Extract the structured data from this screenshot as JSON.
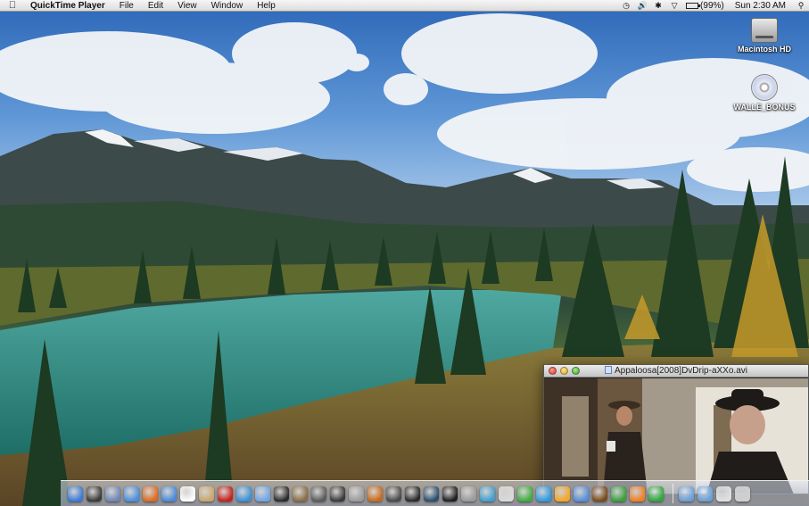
{
  "menubar": {
    "apple_icon": "apple-icon",
    "app_name": "QuickTime Player",
    "menus": [
      "File",
      "Edit",
      "View",
      "Window",
      "Help"
    ],
    "status_icons": [
      "time-machine-icon",
      "volume-icon",
      "bluetooth-icon",
      "wifi-icon",
      "battery-icon"
    ],
    "battery_text": "(99%)",
    "battery_level": 0.99,
    "clock": "Sun 2:30 AM",
    "spotlight_icon": "spotlight-icon"
  },
  "desktop": {
    "icons": [
      {
        "label": "Macintosh HD",
        "icon": "hard-drive-icon"
      },
      {
        "label": "WALLE_BONUS",
        "icon": "disc-icon"
      }
    ]
  },
  "quicktime": {
    "title": "Appaloosa[2008]DvDrip-aXXo.avi"
  },
  "dock": {
    "apps": [
      {
        "icon": "finder-icon",
        "color": "#3b7bd8"
      },
      {
        "icon": "dashboard-icon",
        "color": "#3a3a3a"
      },
      {
        "icon": "preview-icon",
        "color": "#6f86b5"
      },
      {
        "icon": "safari-icon",
        "color": "#4b8fe0"
      },
      {
        "icon": "firefox-icon",
        "color": "#e06a1f"
      },
      {
        "icon": "ichat-icon",
        "color": "#4a8ad8"
      },
      {
        "icon": "ical-icon",
        "color": "#ffffff"
      },
      {
        "icon": "address-book-icon",
        "color": "#c9a66b"
      },
      {
        "icon": "red-app-icon",
        "color": "#c8201a"
      },
      {
        "icon": "itunes-icon",
        "color": "#3b92d8"
      },
      {
        "icon": "itunes-store-icon",
        "color": "#6fa6e6"
      },
      {
        "icon": "dvd-player-icon",
        "color": "#2b2b2b"
      },
      {
        "icon": "iphoto-icon",
        "color": "#8a6d46"
      },
      {
        "icon": "imovie-icon",
        "color": "#5b5b5b"
      },
      {
        "icon": "final-cut-icon",
        "color": "#3a3a3a"
      },
      {
        "icon": "network-icon",
        "color": "#9c9c9c"
      },
      {
        "icon": "firefox-alt-icon",
        "color": "#c86a1a"
      },
      {
        "icon": "spaces-icon",
        "color": "#4a4a4a"
      },
      {
        "icon": "quicktime-icon",
        "color": "#2a2a2a"
      },
      {
        "icon": "time-machine-dock-icon",
        "color": "#2b4f6e"
      },
      {
        "icon": "dvd-icon",
        "color": "#1e1e1e"
      },
      {
        "icon": "photo-booth-icon",
        "color": "#9a9a9a"
      },
      {
        "icon": "automator-icon",
        "color": "#3fa0d0"
      },
      {
        "icon": "transmission-icon",
        "color": "#d9d9d9"
      },
      {
        "icon": "utility-icon",
        "color": "#3fae3f"
      },
      {
        "icon": "skype-icon",
        "color": "#2f9be0"
      },
      {
        "icon": "adium-icon",
        "color": "#f5a623"
      },
      {
        "icon": "finder-alt-icon",
        "color": "#5a8fd9"
      },
      {
        "icon": "coffee-icon",
        "color": "#7a4a1a"
      },
      {
        "icon": "script-icon",
        "color": "#3aa03a"
      },
      {
        "icon": "vlc-icon",
        "color": "#f08020"
      },
      {
        "icon": "utorrent-icon",
        "color": "#2fa83a"
      }
    ],
    "stacks": [
      {
        "icon": "applications-folder-icon",
        "color": "#6a9fd8"
      },
      {
        "icon": "downloads-folder-icon",
        "color": "#6a9fd8"
      },
      {
        "icon": "documents-icon",
        "color": "#e0e0e0"
      },
      {
        "icon": "trash-icon",
        "color": "#cfcfcf"
      }
    ]
  }
}
